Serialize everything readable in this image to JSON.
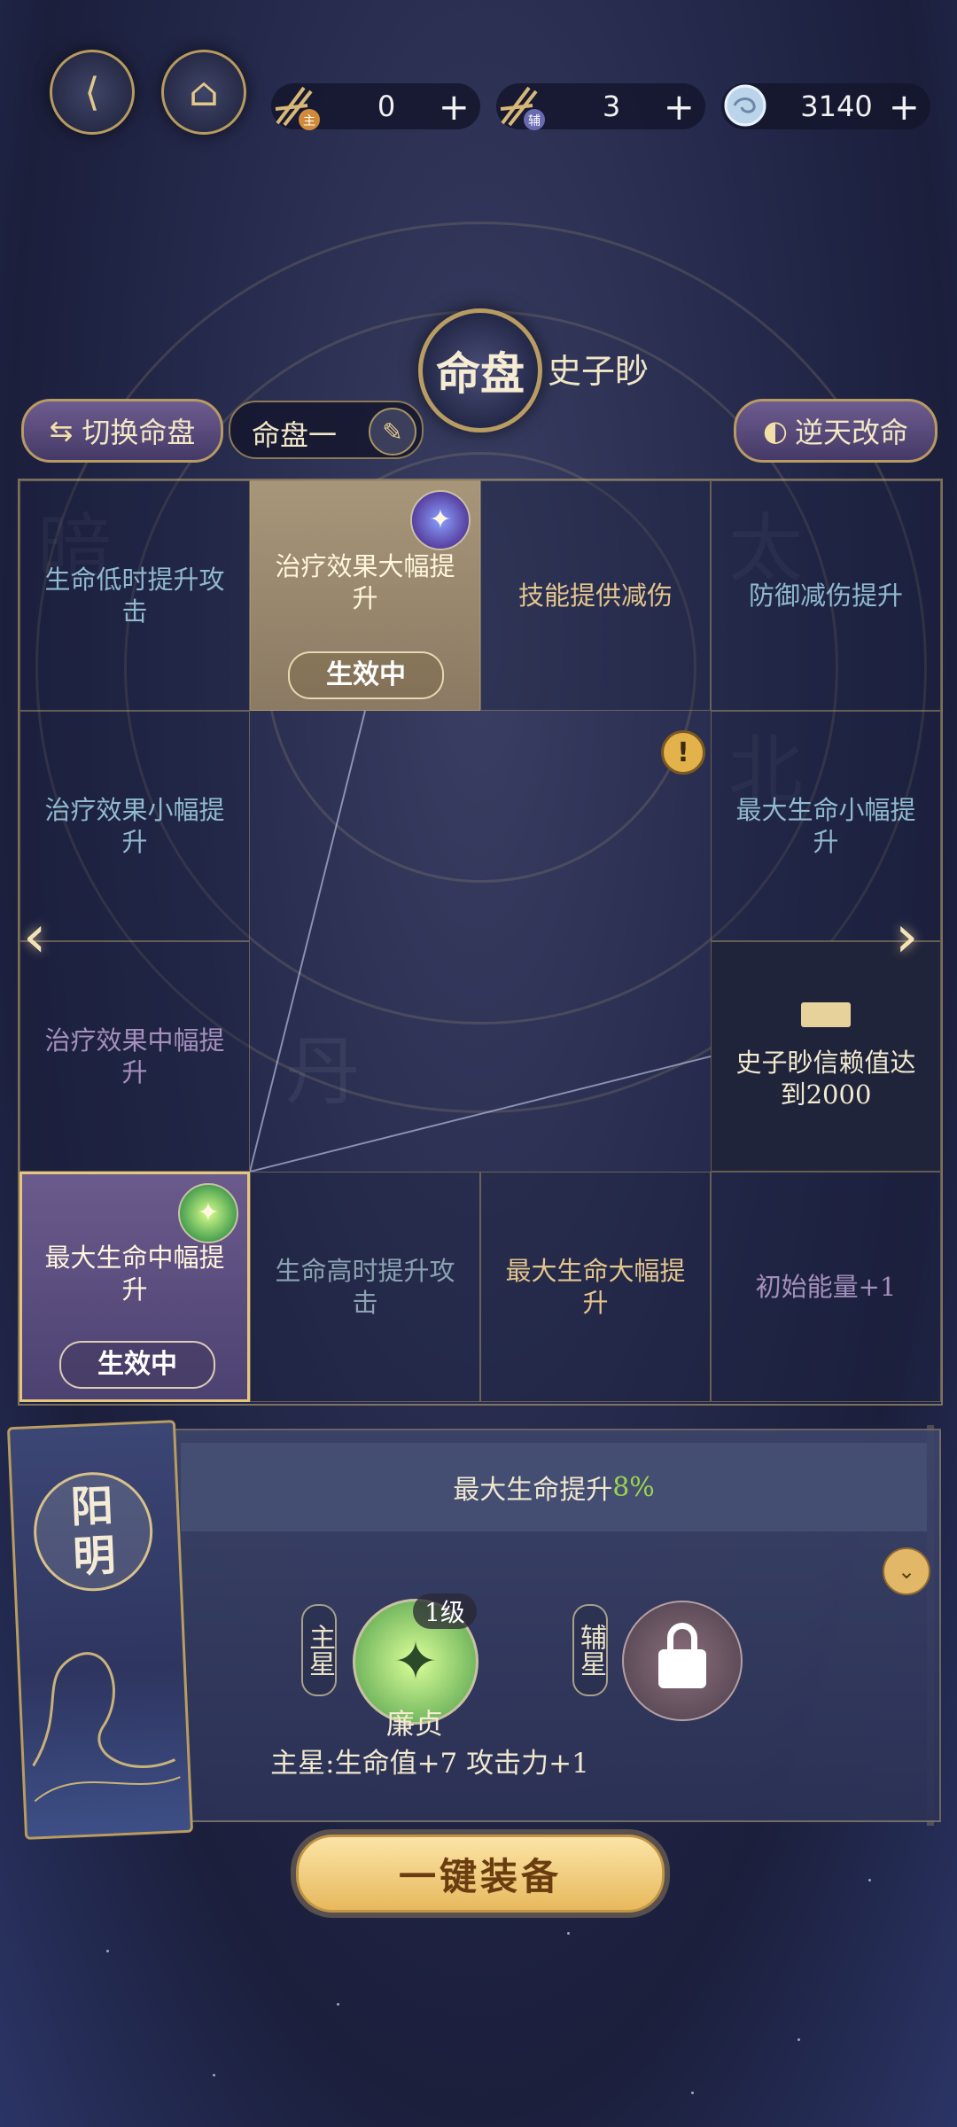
{
  "top_bar": {
    "main_token_value": "0",
    "main_token_badge": "主",
    "sub_token_value": "3",
    "sub_token_badge": "辅",
    "orb_value": "3140",
    "plus": "+"
  },
  "header": {
    "chart_title": "命盘",
    "character_name": "史子眇",
    "switch_label": "切换命盘",
    "chart_select_label": "命盘一",
    "defy_label": "逆天改命"
  },
  "grid": {
    "cells": [
      {
        "text": "生命低时提升攻击"
      },
      {
        "text": "治疗效果大幅提升",
        "badge": "生效中"
      },
      {
        "text": "技能提供减伤"
      },
      {
        "text": "防御减伤提升"
      },
      {
        "text": "治疗效果小幅提升"
      },
      {
        "text": "最大生命小幅提升"
      },
      {
        "text": "治疗效果中幅提升"
      },
      {
        "text": "史子眇信赖值达到2000"
      },
      {
        "text": "最大生命中幅提升",
        "badge": "生效中"
      },
      {
        "text": "生命高时提升攻击"
      },
      {
        "text": "最大生命大幅提升"
      },
      {
        "text": "初始能量+1"
      }
    ],
    "warning": "!",
    "prev_arrow": "‹",
    "next_arrow": "›"
  },
  "panel": {
    "card_name_1": "阳",
    "card_name_2": "明",
    "effect_text": "最大生命提升",
    "effect_pct": "8%",
    "main_label": "主星",
    "sub_label": "辅星",
    "level": "1级",
    "star_name": "廉贞",
    "star_effect": "主星:生命值+7 攻击力+1"
  },
  "equip_button": "一键装备",
  "colors": {
    "accent_gold": "#e3c48c",
    "active_cell": "#a79679",
    "active_purple": "#6b5a8c",
    "pct_green": "#9bd24e"
  }
}
